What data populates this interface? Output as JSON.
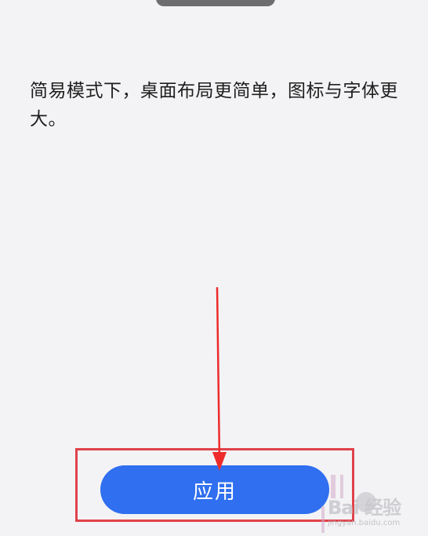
{
  "screen": {
    "description": "简易模式下，桌面布局更简单，图标与字体更大。"
  },
  "apply_button": {
    "label": "应用"
  },
  "watermark": {
    "logo": "Bai  经验",
    "site": "jingyan.baidu.com"
  },
  "colors": {
    "background": "#f3f3f5",
    "button": "#2f6ff0",
    "annotation": "#e0424a",
    "handle": "#6d6d70"
  }
}
